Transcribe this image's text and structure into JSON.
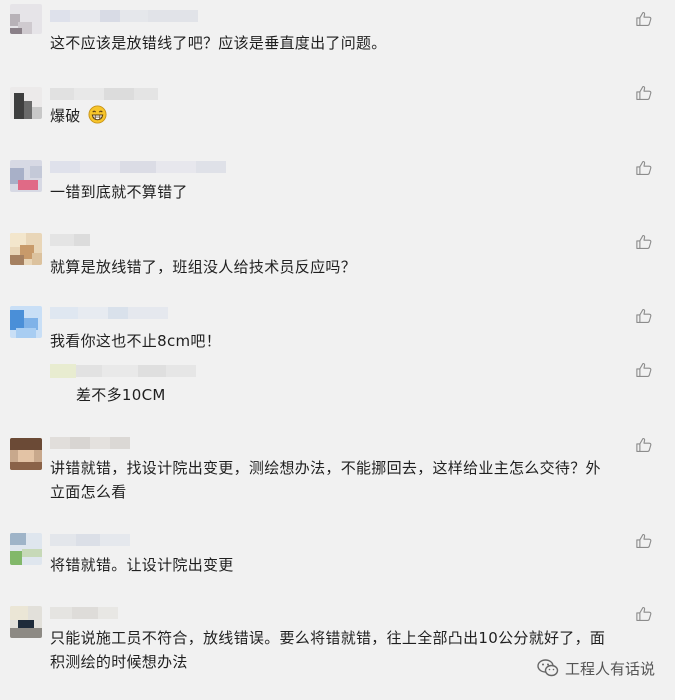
{
  "comments": [
    {
      "text": "这不应该是放错线了吧？应该是垂直度出了问题。"
    },
    {
      "text": "爆破",
      "emoji": "grinning-face-icon"
    },
    {
      "text": "一错到底就不算错了"
    },
    {
      "text": "就算是放线错了，班组没人给技术员反应吗？"
    },
    {
      "text": "我看你这也不止8cm吧！",
      "reply": {
        "text": "差不多10CM"
      }
    },
    {
      "text_line1": "讲错就错，找设计院出变更，测绘想办法，不能挪回去，这样给业主怎么交待？外",
      "text_line2": "立面怎么看"
    },
    {
      "text": "将错就错。让设计院出变更"
    },
    {
      "text_line1": "只能说施工员不符合，放线错误。要么将错就错，往上全部凸出10公分就好了，面",
      "text_line2": "积测绘的时候想办法"
    }
  ],
  "icons": {
    "like": "thumbs-up-icon",
    "watermark_logo": "wechat-icon"
  },
  "watermark": {
    "text": "工程人有话说"
  },
  "colors": {
    "background": "#f1f1f1",
    "text": "#1f1f1f",
    "like_icon": "#8c8c8c"
  }
}
